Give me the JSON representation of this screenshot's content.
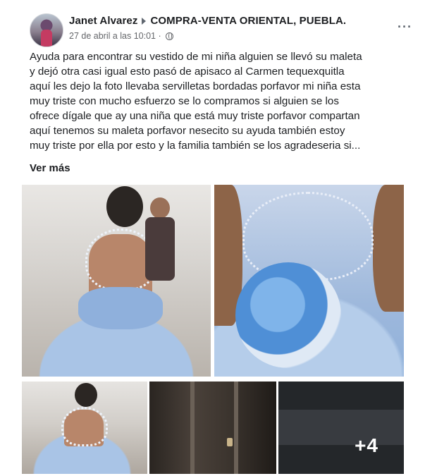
{
  "post": {
    "author": "Janet Alvarez",
    "group": "COMPRA-VENTA ORIENTAL, PUEBLA.",
    "timestamp": "27 de abril a las 10:01",
    "separator": "·",
    "more_icon": "···",
    "text_lines": [
      "Ayuda para encontrar su vestido de mi niña alguien se llevó su maleta",
      "y dejó otra casi igual esto pasó de apisaco al Carmen tequexquitla",
      "aquí les dejo la foto llevaba servilletas bordadas porfavor mi niña esta",
      "muy triste con mucho esfuerzo se lo compramos si alguien se  los",
      "ofrece dígale que ay una niña que está muy triste porfavor compartan",
      "aquí tenemos su maleta  porfavor nesecito su ayuda también estoy",
      "muy triste por ella por esto y la familia también se los agradeseria si..."
    ],
    "see_more": "Ver más",
    "extra_photos_label": "+4"
  },
  "icons": {
    "avatar": "profile-avatar",
    "arrow": "triangle-right-icon",
    "globe": "globe-icon",
    "more": "ellipsis-icon"
  }
}
